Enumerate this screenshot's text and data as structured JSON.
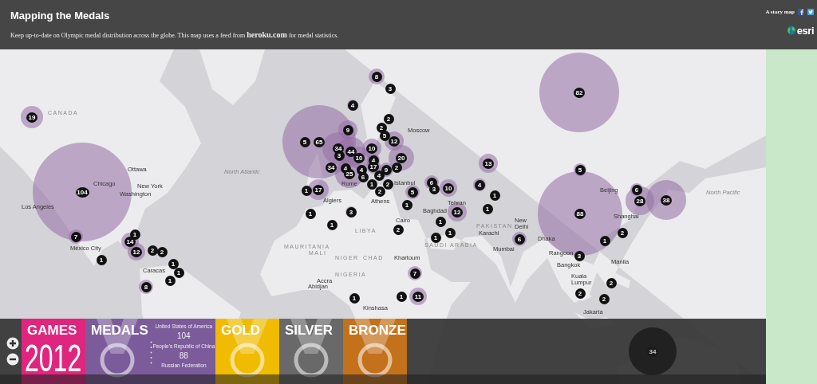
{
  "header": {
    "title": "Mapping the Medals",
    "subtitle": "Keep up-to-date on Olympic medal distribution across the globe. This map uses a feed from **heroku.com** for medal statistics.",
    "story_map_label": "A story map",
    "logo_text": "esri"
  },
  "map": {
    "place_labels": [
      {
        "text": "Ottawa",
        "kind": "city"
      },
      {
        "text": "Chicago",
        "kind": "city"
      },
      {
        "text": "New York",
        "kind": "city"
      },
      {
        "text": "Washington",
        "kind": "city"
      },
      {
        "text": "Los Angeles",
        "kind": "city"
      },
      {
        "text": "México City",
        "kind": "city"
      },
      {
        "text": "Caracas",
        "kind": "city"
      },
      {
        "text": "Moscow",
        "kind": "city"
      },
      {
        "text": "Rome",
        "kind": "city"
      },
      {
        "text": "Istanbul",
        "kind": "city"
      },
      {
        "text": "Algiers",
        "kind": "city"
      },
      {
        "text": "Athens",
        "kind": "city"
      },
      {
        "text": "Cairo",
        "kind": "city"
      },
      {
        "text": "Baghdad",
        "kind": "city"
      },
      {
        "text": "Tehran",
        "kind": "city"
      },
      {
        "text": "Karachi",
        "kind": "city"
      },
      {
        "text": "New Delhi",
        "kind": "city"
      },
      {
        "text": "Mumbai",
        "kind": "city"
      },
      {
        "text": "Dhaka",
        "kind": "city"
      },
      {
        "text": "Beijing",
        "kind": "city"
      },
      {
        "text": "Shanghai",
        "kind": "city"
      },
      {
        "text": "Rangoon",
        "kind": "city"
      },
      {
        "text": "Bangkok",
        "kind": "city"
      },
      {
        "text": "Manila",
        "kind": "city"
      },
      {
        "text": "Kuala Lumpur",
        "kind": "city"
      },
      {
        "text": "Jakarta",
        "kind": "city"
      },
      {
        "text": "Khartoum",
        "kind": "city"
      },
      {
        "text": "Accra",
        "kind": "city"
      },
      {
        "text": "Abidjan",
        "kind": "city"
      },
      {
        "text": "Kinshasa",
        "kind": "city"
      },
      {
        "text": "North Atlantic",
        "kind": "ocean"
      },
      {
        "text": "North Pacific",
        "kind": "ocean"
      },
      {
        "text": "CANADA",
        "kind": "country"
      },
      {
        "text": "MAURITANIA",
        "kind": "country"
      },
      {
        "text": "MALI",
        "kind": "country"
      },
      {
        "text": "NIGER",
        "kind": "country"
      },
      {
        "text": "CHAD",
        "kind": "country"
      },
      {
        "text": "NIGERIA",
        "kind": "country"
      },
      {
        "text": "LIBYA",
        "kind": "country"
      },
      {
        "text": "SAUDI ARABIA",
        "kind": "country"
      },
      {
        "text": "PAKISTAN",
        "kind": "country"
      }
    ],
    "clusters": [
      {
        "count": "19"
      },
      {
        "count": "104"
      },
      {
        "count": "7"
      },
      {
        "count": "1"
      },
      {
        "count": "1"
      },
      {
        "count": "14"
      },
      {
        "count": "12"
      },
      {
        "count": "2"
      },
      {
        "count": "2"
      },
      {
        "count": "1"
      },
      {
        "count": "1"
      },
      {
        "count": "1"
      },
      {
        "count": "8"
      },
      {
        "count": "8"
      },
      {
        "count": "3"
      },
      {
        "count": "4"
      },
      {
        "count": "2"
      },
      {
        "count": "2"
      },
      {
        "count": "5"
      },
      {
        "count": "12"
      },
      {
        "count": "20"
      },
      {
        "count": "2"
      },
      {
        "count": "9"
      },
      {
        "count": "5"
      },
      {
        "count": "65"
      },
      {
        "count": "9"
      },
      {
        "count": "34"
      },
      {
        "count": "3"
      },
      {
        "count": "44"
      },
      {
        "count": "10"
      },
      {
        "count": "10"
      },
      {
        "count": "4"
      },
      {
        "count": "34"
      },
      {
        "count": "17"
      },
      {
        "count": "4"
      },
      {
        "count": "25"
      },
      {
        "count": "4"
      },
      {
        "count": "6"
      },
      {
        "count": "1"
      },
      {
        "count": "4"
      },
      {
        "count": "2"
      },
      {
        "count": "1"
      },
      {
        "count": "17"
      },
      {
        "count": "2"
      },
      {
        "count": "5"
      },
      {
        "count": "1"
      },
      {
        "count": "3"
      },
      {
        "count": "1"
      },
      {
        "count": "1"
      },
      {
        "count": "2"
      },
      {
        "count": "1"
      },
      {
        "count": "1"
      },
      {
        "count": "1"
      },
      {
        "count": "6"
      },
      {
        "count": "3"
      },
      {
        "count": "10"
      },
      {
        "count": "12"
      },
      {
        "count": "4"
      },
      {
        "count": "13"
      },
      {
        "count": "1"
      },
      {
        "count": "1"
      },
      {
        "count": "82"
      },
      {
        "count": "5"
      },
      {
        "count": "88"
      },
      {
        "count": "6"
      },
      {
        "count": "28"
      },
      {
        "count": "38"
      },
      {
        "count": "2"
      },
      {
        "count": "1"
      },
      {
        "count": "3"
      },
      {
        "count": "2"
      },
      {
        "count": "2"
      },
      {
        "count": "2"
      },
      {
        "count": "6"
      },
      {
        "count": "7"
      },
      {
        "count": "1"
      },
      {
        "count": "11"
      },
      {
        "count": "1"
      },
      {
        "count": "34"
      }
    ]
  },
  "tiles": [
    {
      "kind": "games",
      "title": "GAMES",
      "year": "2012",
      "color": "#e0257f"
    },
    {
      "kind": "leaders",
      "title": "MEDALS",
      "color": "#7c5b9b",
      "leaders": [
        {
          "country": "United States of America",
          "total": "104"
        },
        {
          "country": "People's Republic of China",
          "total": "88"
        },
        {
          "country": "Russian Federation"
        }
      ]
    },
    {
      "kind": "medal",
      "title": "GOLD",
      "color": "#f0bb00"
    },
    {
      "kind": "medal",
      "title": "SILVER",
      "color": "#696969"
    },
    {
      "kind": "medal",
      "title": "BRONZE",
      "color": "#c4711c"
    }
  ]
}
